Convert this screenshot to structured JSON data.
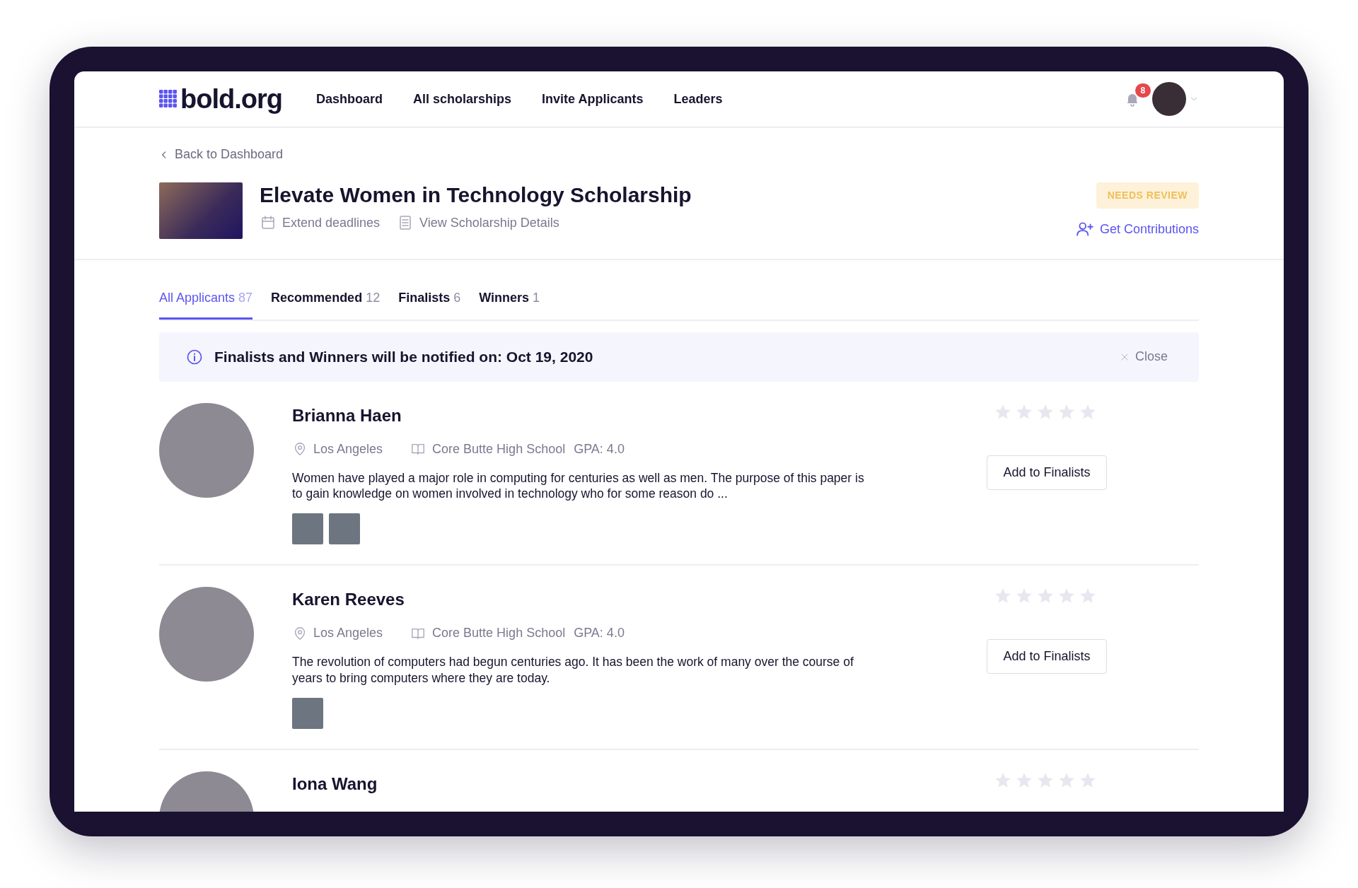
{
  "nav": {
    "logo": "bold.org",
    "links": [
      "Dashboard",
      "All scholarships",
      "Invite Applicants",
      "Leaders"
    ],
    "notifications": "8"
  },
  "back_link": "Back to Dashboard",
  "scholarship": {
    "title": "Elevate Women in Technology Scholarship",
    "actions": [
      "Extend deadlines",
      "View Scholarship Details"
    ],
    "status": "NEEDS REVIEW",
    "contributions_link": "Get Contributions"
  },
  "tabs": [
    {
      "label": "All Applicants",
      "count": "87",
      "selected": true
    },
    {
      "label": "Recommended",
      "count": "12",
      "selected": false
    },
    {
      "label": "Finalists",
      "count": "6",
      "selected": false
    },
    {
      "label": "Winners",
      "count": "1",
      "selected": false
    }
  ],
  "notice": {
    "text": "Finalists and Winners will be notified on: Oct 19, 2020",
    "close": "Close"
  },
  "applicants": [
    {
      "name": "Brianna Haen",
      "city": "Los Angeles",
      "school": "Core Butte High School",
      "gpa": "GPA: 4.0",
      "essay": "Women have played a major role in computing for centuries as well as men. The purpose of this paper is to gain knowledge on women involved in technology who for some reason do ...",
      "attachments": [
        {
          "kind": "photo"
        },
        {
          "kind": "photo"
        }
      ],
      "stars": 0,
      "action": "Add to Finalists"
    },
    {
      "name": "Karen Reeves",
      "city": "Los Angeles",
      "school": "Core Butte High School",
      "gpa": "GPA: 4.0",
      "essay": "The revolution of computers had begun centuries ago. It has been the work of many over the course of years to bring computers where they are today.",
      "attachments": [
        {
          "kind": "photo"
        }
      ],
      "stars": 0,
      "action": "Add to Finalists"
    },
    {
      "name": "Iona Wang",
      "stars": 0
    }
  ]
}
